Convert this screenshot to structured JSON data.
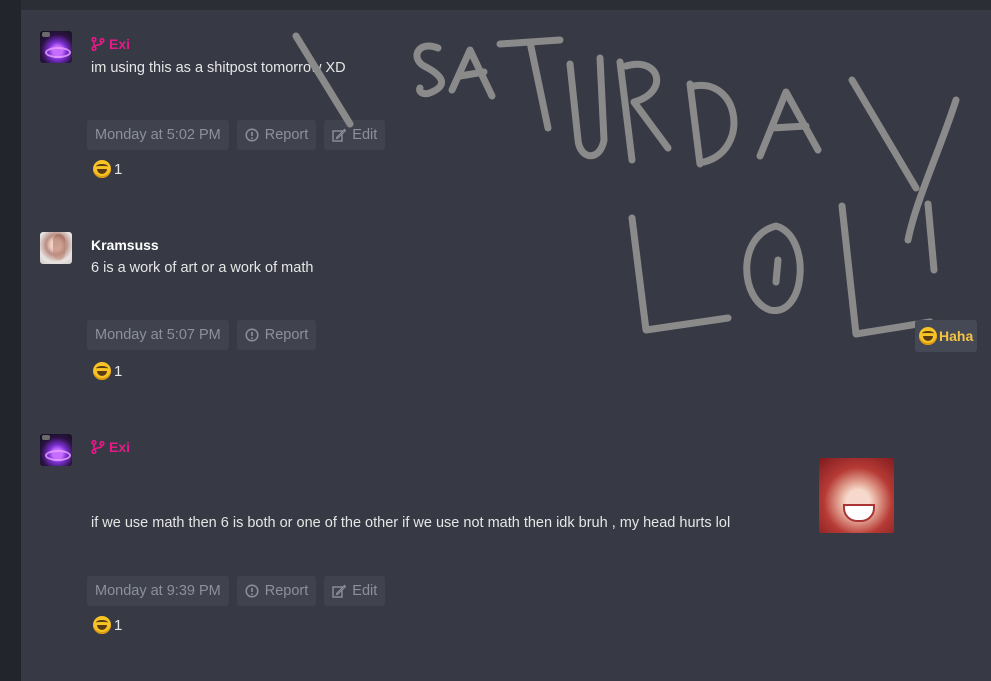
{
  "posts": [
    {
      "author": "Exi",
      "message": "im using this as a shitpost tomorrow XD",
      "timestamp": "Monday at 5:02 PM",
      "actions": [
        "Report",
        "Edit"
      ],
      "reaction_count": "1"
    },
    {
      "author": "Kramsuss",
      "message": "6 is a work of art or a work of math",
      "timestamp": "Monday at 5:07 PM",
      "actions": [
        "Report"
      ],
      "reaction_count": "1"
    },
    {
      "author": "Exi",
      "message": "if we use math then 6 is both or one of the other if we use not math then idk bruh , my head hurts lol",
      "timestamp": "Monday at 9:39 PM",
      "actions": [
        "Report",
        "Edit"
      ],
      "reaction_count": "1"
    }
  ],
  "haha_label": "Haha",
  "colors": {
    "panel": "#373a44",
    "staff_name": "#e8188a",
    "action_bg": "#40434e",
    "action_text": "#8d909b",
    "haha": "#f5c341",
    "scribble": "#8a8a8a"
  },
  "icons": [
    "staff-branch-icon",
    "report-icon",
    "edit-icon",
    "laughing-emoji-icon"
  ]
}
